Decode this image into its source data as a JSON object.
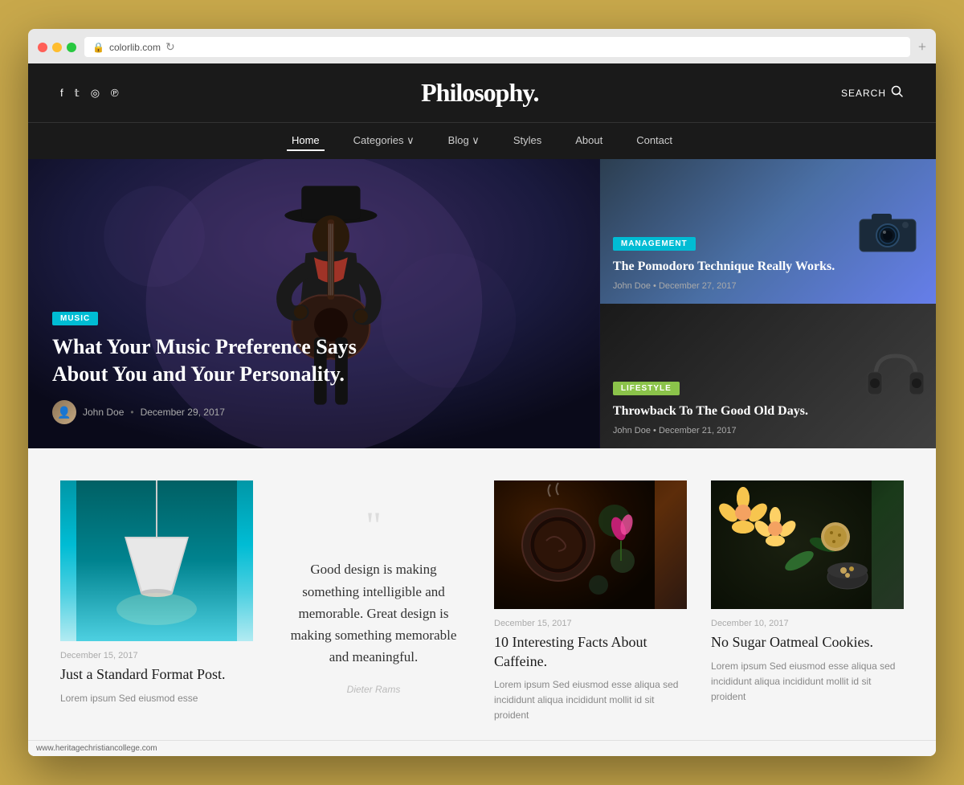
{
  "browser": {
    "url": "colorlib.com",
    "refresh_icon": "↻",
    "plus_icon": "+"
  },
  "header": {
    "logo": "Philosophy.",
    "search_label": "SEARCH",
    "social_icons": [
      "f",
      "𝕏",
      "◉",
      "⊕"
    ]
  },
  "nav": {
    "items": [
      {
        "label": "Home",
        "active": true
      },
      {
        "label": "Categories ∨",
        "active": false
      },
      {
        "label": "Blog ∨",
        "active": false
      },
      {
        "label": "Styles",
        "active": false
      },
      {
        "label": "About",
        "active": false
      },
      {
        "label": "Contact",
        "active": false
      }
    ]
  },
  "hero": {
    "main_article": {
      "tag": "MUSIC",
      "title": "What Your Music Preference Says About You and Your Personality.",
      "author": "John Doe",
      "date": "December 29, 2017"
    },
    "side_articles": [
      {
        "tag": "MANAGEMENT",
        "title": "The Pomodoro Technique Really Works.",
        "author": "John Doe",
        "date": "December 27, 2017"
      },
      {
        "tag": "LIFESTYLE",
        "title": "Throwback To The Good Old Days.",
        "author": "John Doe",
        "date": "December 21, 2017"
      }
    ]
  },
  "posts": [
    {
      "type": "image",
      "date": "December 15, 2017",
      "title": "Just a Standard Format Post.",
      "excerpt": "Lorem ipsum Sed eiusmod esse"
    },
    {
      "type": "quote",
      "quote_text": "Good design is making something intelligible and memorable. Great design is making something memorable and meaningful.",
      "quote_author": "Dieter Rams"
    },
    {
      "type": "image",
      "date": "December 15, 2017",
      "title": "10 Interesting Facts About Caffeine.",
      "excerpt": "Lorem ipsum Sed eiusmod esse aliqua sed incididunt aliqua incididunt mollit id sit proident"
    },
    {
      "type": "image",
      "date": "December 10, 2017",
      "title": "No Sugar Oatmeal Cookies.",
      "excerpt": "Lorem ipsum Sed eiusmod esse aliqua sed incididunt aliqua incididunt mollit id sit proident"
    }
  ],
  "status_bar": {
    "url": "www.heritagechristiancollege.com"
  }
}
